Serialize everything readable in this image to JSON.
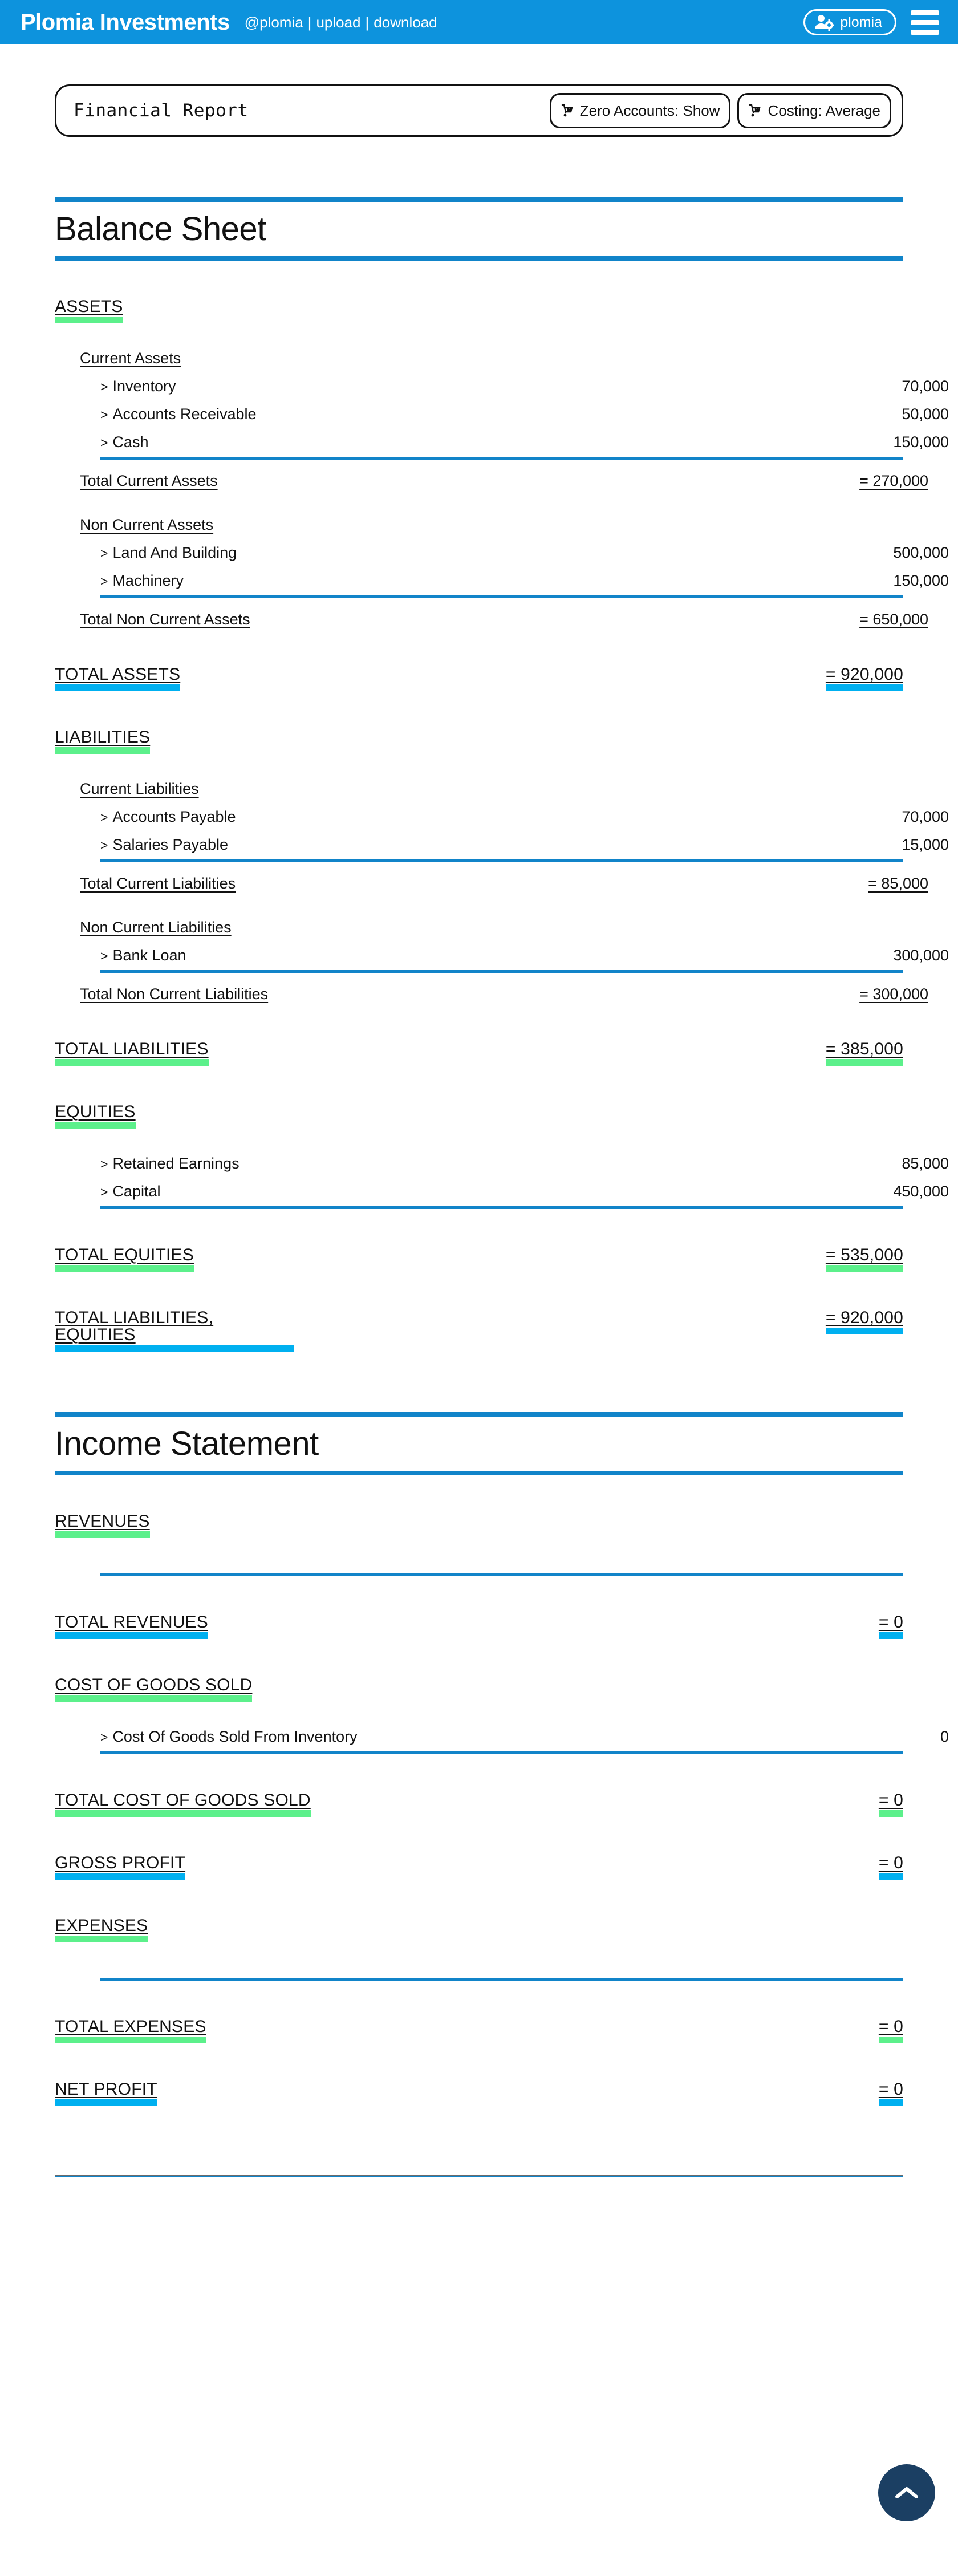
{
  "header": {
    "brand": "Plomia Investments",
    "handle": "@plomia",
    "sep": "|",
    "upload_label": "upload",
    "download_label": "download",
    "user_label": "plomia",
    "user_icon": "user-gear-icon",
    "menu_icon": "hamburger-menu-icon",
    "bar_color": "#0d93dd"
  },
  "toolbar": {
    "title": "Financial Report",
    "buttons": [
      {
        "icon": "hand-truck-icon",
        "label": "Zero Accounts: Show"
      },
      {
        "icon": "hand-truck-icon",
        "label": "Costing: Average"
      }
    ]
  },
  "colors": {
    "accent_blue": "#1184c9",
    "highlight_green": "#5cf08b",
    "highlight_blue": "#00b0f0",
    "scroll_top_bg": "#1b3f63"
  },
  "reports": [
    {
      "title": "Balance Sheet",
      "sections": [
        {
          "name": "ASSETS",
          "highlight": "green",
          "groups": [
            {
              "name": "Current Assets",
              "items": [
                {
                  "label": "Inventory",
                  "value": "70,000"
                },
                {
                  "label": "Accounts Receivable",
                  "value": "50,000"
                },
                {
                  "label": "Cash",
                  "value": "150,000"
                }
              ],
              "total_label": "Total Current Assets",
              "total_value": "= 270,000"
            },
            {
              "name": "Non Current Assets",
              "items": [
                {
                  "label": "Land And Building",
                  "value": "500,000"
                },
                {
                  "label": "Machinery",
                  "value": "150,000"
                }
              ],
              "total_label": "Total Non Current Assets",
              "total_value": "= 650,000"
            }
          ],
          "grand_total_label": "TOTAL ASSETS",
          "grand_total_value": "= 920,000",
          "grand_total_highlight": "blue"
        },
        {
          "name": "LIABILITIES",
          "highlight": "green",
          "groups": [
            {
              "name": "Current Liabilities",
              "items": [
                {
                  "label": "Accounts Payable",
                  "value": "70,000"
                },
                {
                  "label": "Salaries Payable",
                  "value": "15,000"
                }
              ],
              "total_label": "Total Current Liabilities",
              "total_value": "= 85,000"
            },
            {
              "name": "Non Current Liabilities",
              "items": [
                {
                  "label": "Bank Loan",
                  "value": "300,000"
                }
              ],
              "total_label": "Total Non Current Liabilities",
              "total_value": "= 300,000"
            }
          ],
          "grand_total_label": "TOTAL LIABILITIES",
          "grand_total_value": "= 385,000",
          "grand_total_highlight": "green"
        },
        {
          "name": "EQUITIES",
          "highlight": "green",
          "groups": [
            {
              "name": "",
              "items": [
                {
                  "label": "Retained Earnings",
                  "value": "85,000"
                },
                {
                  "label": "Capital",
                  "value": "450,000"
                }
              ],
              "total_label": "",
              "total_value": ""
            }
          ],
          "grand_total_label": "TOTAL EQUITIES",
          "grand_total_value": "= 535,000",
          "grand_total_highlight": "green"
        }
      ],
      "footer_total_label": "TOTAL LIABILITIES, EQUITIES",
      "footer_total_value": "= 920,000",
      "footer_total_highlight": "blue"
    },
    {
      "title": "Income Statement",
      "sections": [
        {
          "name": "REVENUES",
          "highlight": "green",
          "groups": [],
          "grand_total_label": "TOTAL REVENUES",
          "grand_total_value": "= 0",
          "grand_total_highlight": "blue"
        },
        {
          "name": "COST OF GOODS SOLD",
          "highlight": "green",
          "groups": [
            {
              "name": "",
              "items": [
                {
                  "label": "Cost Of Goods Sold From Inventory",
                  "value": "0"
                }
              ],
              "total_label": "",
              "total_value": ""
            }
          ],
          "grand_total_label": "TOTAL COST OF GOODS SOLD",
          "grand_total_value": "= 0",
          "grand_total_highlight": "green"
        },
        {
          "name": "GROSS PROFIT",
          "highlight": "blue",
          "is_standalone_total": true,
          "standalone_value": "= 0",
          "groups": []
        },
        {
          "name": "EXPENSES",
          "highlight": "green",
          "groups": [],
          "grand_total_label": "TOTAL EXPENSES",
          "grand_total_value": "= 0",
          "grand_total_highlight": "green"
        },
        {
          "name": "NET PROFIT",
          "highlight": "blue",
          "is_standalone_total": true,
          "standalone_value": "= 0",
          "groups": []
        }
      ]
    }
  ],
  "scroll_top": {
    "icon": "chevron-up-icon"
  },
  "chevron": ">"
}
